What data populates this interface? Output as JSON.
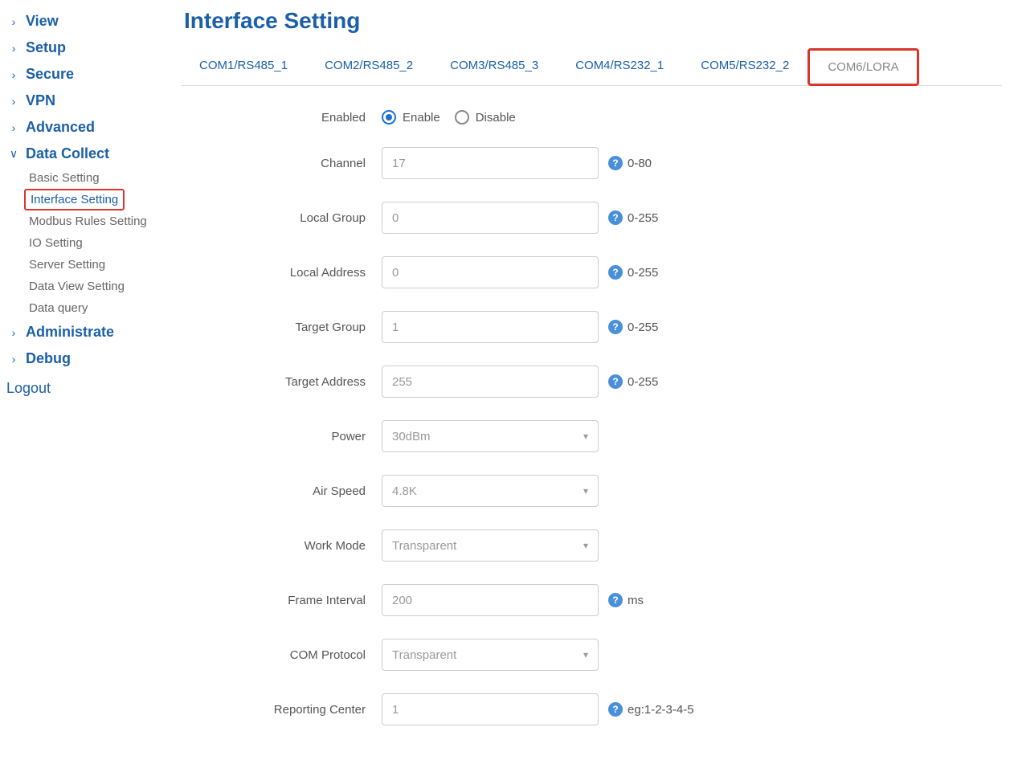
{
  "sidebar": {
    "items": [
      {
        "label": "View",
        "expanded": false
      },
      {
        "label": "Setup",
        "expanded": false
      },
      {
        "label": "Secure",
        "expanded": false
      },
      {
        "label": "VPN",
        "expanded": false
      },
      {
        "label": "Advanced",
        "expanded": false
      },
      {
        "label": "Data Collect",
        "expanded": true,
        "children": [
          {
            "label": "Basic Setting",
            "active": false
          },
          {
            "label": "Interface Setting",
            "active": true
          },
          {
            "label": "Modbus Rules Setting",
            "active": false
          },
          {
            "label": "IO Setting",
            "active": false
          },
          {
            "label": "Server Setting",
            "active": false
          },
          {
            "label": "Data View Setting",
            "active": false
          },
          {
            "label": "Data query",
            "active": false
          }
        ]
      },
      {
        "label": "Administrate",
        "expanded": false
      },
      {
        "label": "Debug",
        "expanded": false
      }
    ],
    "logout_label": "Logout"
  },
  "page_title": "Interface Setting",
  "tabs": [
    {
      "label": "COM1/RS485_1"
    },
    {
      "label": "COM2/RS485_2"
    },
    {
      "label": "COM3/RS485_3"
    },
    {
      "label": "COM4/RS232_1"
    },
    {
      "label": "COM5/RS232_2"
    },
    {
      "label": "COM6/LORA"
    }
  ],
  "form": {
    "enabled": {
      "label": "Enabled",
      "options": [
        "Enable",
        "Disable"
      ],
      "value": "Enable"
    },
    "channel": {
      "label": "Channel",
      "value": "17",
      "hint": "0-80"
    },
    "local_group": {
      "label": "Local Group",
      "value": "0",
      "hint": "0-255"
    },
    "local_address": {
      "label": "Local Address",
      "value": "0",
      "hint": "0-255"
    },
    "target_group": {
      "label": "Target Group",
      "value": "1",
      "hint": "0-255"
    },
    "target_address": {
      "label": "Target Address",
      "value": "255",
      "hint": "0-255"
    },
    "power": {
      "label": "Power",
      "value": "30dBm"
    },
    "air_speed": {
      "label": "Air Speed",
      "value": "4.8K"
    },
    "work_mode": {
      "label": "Work Mode",
      "value": "Transparent"
    },
    "frame_interval": {
      "label": "Frame Interval",
      "value": "200",
      "hint": "ms"
    },
    "com_protocol": {
      "label": "COM Protocol",
      "value": "Transparent"
    },
    "reporting_center": {
      "label": "Reporting Center",
      "value": "1",
      "hint": "eg:1-2-3-4-5"
    }
  }
}
